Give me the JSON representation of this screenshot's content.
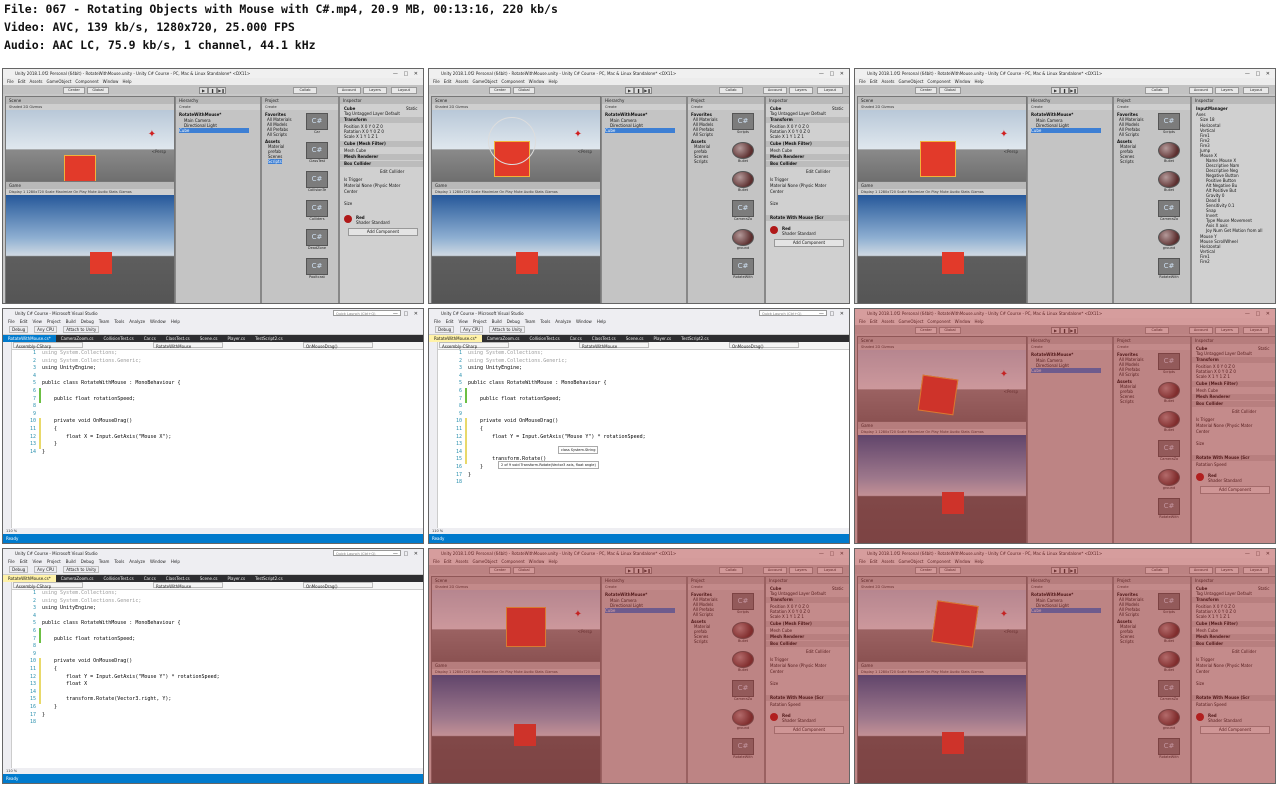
{
  "header": {
    "file_line": "File: 067 - Rotating Objects with Mouse with C#.mp4, 20.9 MB, 00:13:16, 220 kb/s",
    "video_line": "Video: AVC, 139 kb/s, 1280x720, 25.000 FPS",
    "audio_line": "Audio: AAC LC, 75.9 kb/s, 1 channel, 44.1 kHz"
  },
  "unity": {
    "title": "Unity 2018.1.0f2 Personal (64bit) - RotateWithMouse.unity - Unity C# Course - PC, Mac & Linux Standalone* <DX11>",
    "menu": [
      "File",
      "Edit",
      "Assets",
      "GameObject",
      "Component",
      "Window",
      "Help"
    ],
    "toolbar": {
      "center": "Center",
      "global": "Global",
      "collab": "Collab",
      "account": "Account",
      "layers": "Layers",
      "layout": "Layout"
    },
    "scene_tab": "Scene",
    "scene_sub": "Shaded   2D   Gizmos",
    "persp": "<Persp",
    "game_tab": "Game",
    "game_sub": "Display 1   1280x720   Scale   Maximize On Play   Mute Audio   Stats   Gizmos",
    "hierarchy_tab": "Hierarchy",
    "hierarchy_create": "Create",
    "hierarchy_root": "RotateWithMouse*",
    "hierarchy_items": [
      "Main Camera",
      "Directional Light",
      "Cube"
    ],
    "project_tab": "Project",
    "project_create": "Create",
    "favorites": [
      "Favorites",
      "All Materials",
      "All Models",
      "All Prefabs",
      "All Scripts"
    ],
    "assets_root": "Assets",
    "asset_folders": [
      "Material",
      "prefab",
      "Scenes",
      "Scripts"
    ],
    "asset_items": [
      "Car",
      "ClassTest",
      "CollisionTe",
      "Colliders",
      "DeadZone",
      "Pooltcast"
    ],
    "asset_items_b": [
      "Scripts",
      "Bullet",
      "Bullet",
      "CameraZo",
      "ground",
      "RotateWith"
    ],
    "inspector_tab": "Inspector",
    "object_name": "Cube",
    "static_label": "Static",
    "tag_layer": "Tag  Untagged   Layer  Default",
    "transform": "Transform",
    "position": "Position  X 0   Y 0   Z 0",
    "rotation": "Rotation  X 0   Y 0   Z 0",
    "scale": "Scale      X 1   Y 1   Z 1",
    "mesh_filter": "Cube (Mesh Filter)",
    "mesh": "Mesh   Cube",
    "mesh_renderer": "Mesh Renderer",
    "box_collider": "Box Collider",
    "edit_collider": "Edit Collider",
    "is_trigger": "Is Trigger",
    "material": "Material   None (Physic Mater",
    "center": "Center",
    "size": "Size",
    "rotate_script": "Rotate With Mouse (Scr",
    "rotation_speed": "Rotation Speed",
    "mat_red": "Red",
    "shader": "Shader   Standard",
    "add_component": "Add Component",
    "input_manager": "InputManager",
    "axes": "Axes",
    "axes_size": "Size   18",
    "axes_list": [
      "Horizontal",
      "Vertical",
      "Fire1",
      "Fire2",
      "Fire3",
      "Jump",
      "Mouse X"
    ],
    "axis_fields": [
      "Name   Mouse X",
      "Descriptive Nam",
      "Descriptive Neg",
      "Negative Button",
      "Positive Button",
      "Alt Negative Bu",
      "Alt Positive But",
      "Gravity   0",
      "Dead   0",
      "Sensitivity  0.1",
      "Snap",
      "Invert",
      "Type   Mouse Movement",
      "Axis   X axis",
      "Joy Num   Get Motion from all"
    ],
    "axes_tail": [
      "Mouse Y",
      "Mouse ScrollWheel",
      "Horizontal",
      "Vertical",
      "Fire1",
      "Fire2"
    ]
  },
  "vs": {
    "title": "Unity C# Course - Microsoft Visual Studio",
    "search": "Quick Launch (Ctrl+Q)",
    "menu": [
      "File",
      "Edit",
      "View",
      "Project",
      "Build",
      "Debug",
      "Team",
      "Tools",
      "Analyze",
      "Window",
      "Help"
    ],
    "toolbar": [
      "Debug",
      "Any CPU",
      "Attach to Unity"
    ],
    "tabs": [
      "RotateWithMouse.cs*",
      "CameraZoom.cs",
      "CollisionTest.cs",
      "Car.cs",
      "ClassTest.cs",
      "Scene.cs",
      "Player.cs",
      "TestScript2.cs"
    ],
    "nav": [
      "Assembly-CSharp",
      "RotateWithMouse",
      "OnMouseDrag()"
    ],
    "zoom": "110 %",
    "status": "Ready",
    "tooltip1": "class System.String",
    "tooltip2": "2 of 9  void Transform.Rotate(Vector3 axis, float angle)",
    "code_common": [
      "using System.Collections;",
      "using System.Collections.Generic;",
      "using UnityEngine;",
      "",
      "public class RotateWithMouse : MonoBehaviour {",
      "",
      "    public float rotationSpeed;",
      "",
      "",
      "    private void OnMouseDrag()",
      "    {"
    ],
    "code_a_tail": [
      "        float X = Input.GetAxis(\"Mouse X\");",
      "    }",
      "}"
    ],
    "code_b_tail": [
      "        float Y = Input.GetAxis(\"Mouse Y\") * rotationSpeed;",
      "",
      "",
      "        transform.Rotate()",
      "    }",
      "}",
      ""
    ],
    "code_c_tail": [
      "        float Y = Input.GetAxis(\"Mouse Y\") * rotationSpeed;",
      "        float X",
      "",
      "        transform.Rotate(Vector3.right, Y);",
      "    }",
      "}",
      ""
    ]
  }
}
